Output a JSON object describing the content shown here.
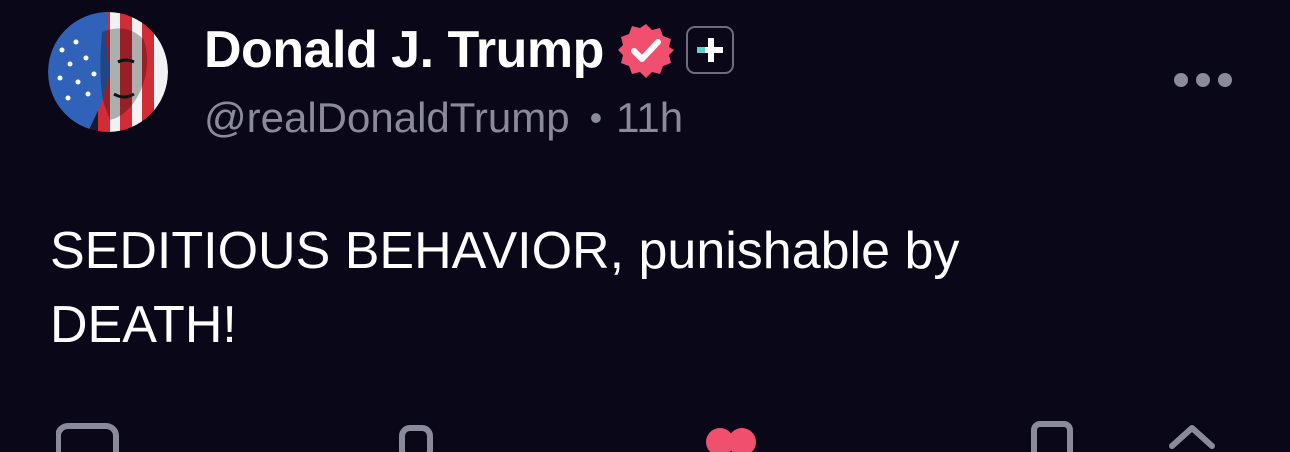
{
  "post": {
    "display_name": "Donald J. Trump",
    "handle": "@realDonaldTrump",
    "separator": "•",
    "timestamp": "11h",
    "text": "SEDITIOUS BEHAVIOR, punishable by\nDEATH!"
  },
  "icons": {
    "avatar": "avatar-flag-portrait",
    "verified": "verified-badge-icon",
    "plus": "plus-badge-icon",
    "more": "more-options-icon",
    "reply": "reply-icon",
    "repost": "repost-icon",
    "like": "heart-icon",
    "save": "bookmark-icon",
    "share": "share-icon"
  },
  "colors": {
    "background": "#0a0719",
    "text_primary": "#ffffff",
    "text_secondary": "#8b8a9c",
    "verified": "#f0506e",
    "plus_accent": "#5ad6c8",
    "like": "#f0506e"
  }
}
